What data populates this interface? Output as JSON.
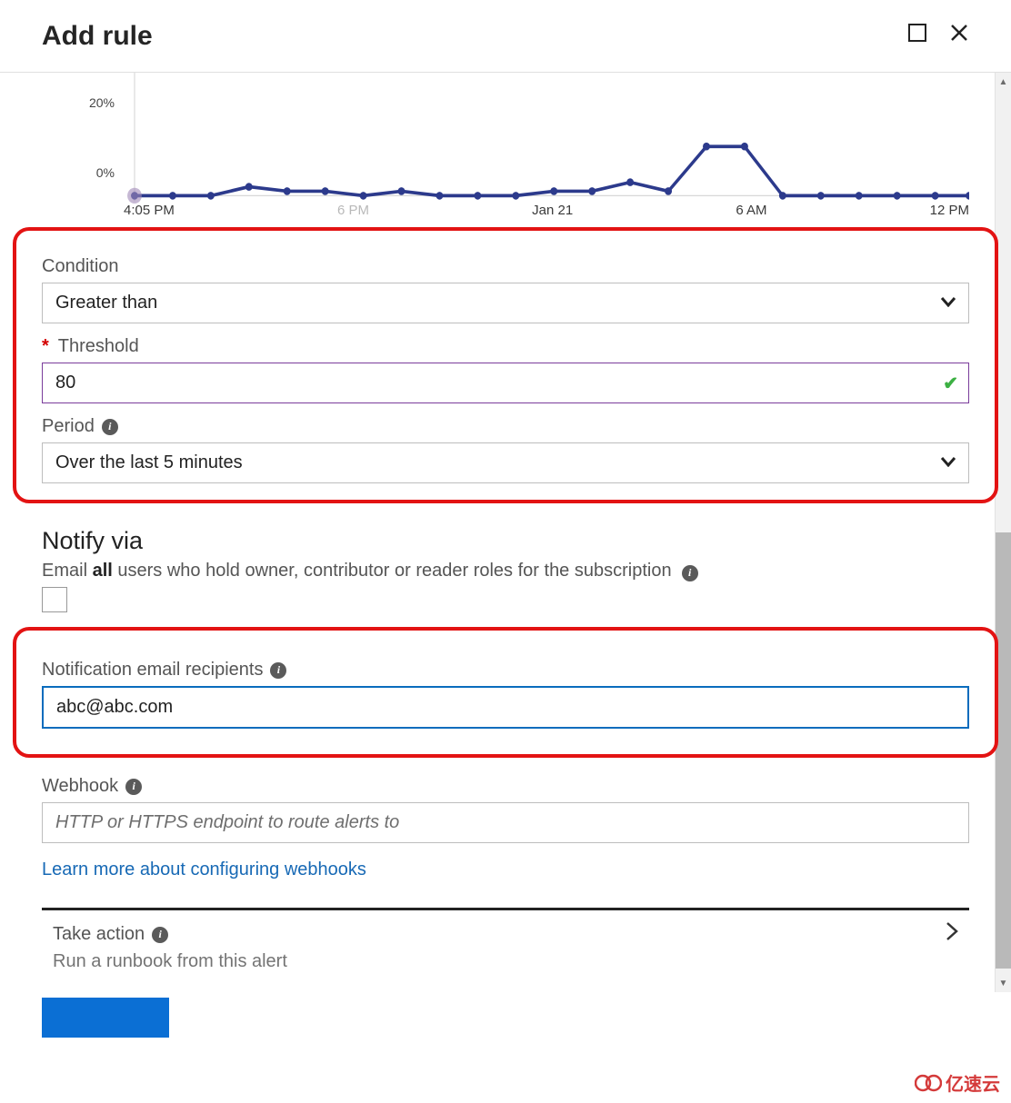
{
  "header": {
    "title": "Add rule"
  },
  "chart_data": {
    "type": "line",
    "title": "",
    "xlabel": "",
    "ylabel": "",
    "ylim": [
      0,
      25
    ],
    "y_ticks": [
      "20%",
      "0%"
    ],
    "x_ticks": [
      "4:05 PM",
      "6 PM",
      "Jan 21",
      "6 AM",
      "12 PM"
    ],
    "x": [
      0,
      1,
      2,
      3,
      4,
      5,
      6,
      7,
      8,
      9,
      10,
      11,
      12,
      13,
      14,
      15,
      16,
      17,
      18,
      19,
      20,
      21,
      22
    ],
    "values": [
      0,
      0,
      0,
      2,
      1,
      1,
      0,
      1,
      0,
      0,
      0,
      1,
      1,
      3,
      1,
      11,
      11,
      0,
      0,
      0,
      0,
      0,
      0
    ]
  },
  "form": {
    "condition_label": "Condition",
    "condition_value": "Greater than",
    "threshold_label": "Threshold",
    "threshold_value": "80",
    "period_label": "Period",
    "period_value": "Over the last 5 minutes"
  },
  "notify": {
    "section_title": "Notify via",
    "email_all_prefix": "Email ",
    "email_all_bold": "all",
    "email_all_suffix": " users who hold owner, contributor or reader roles for the subscription",
    "recipients_label": "Notification email recipients",
    "recipients_value": "abc@abc.com",
    "webhook_label": "Webhook",
    "webhook_placeholder": "HTTP or HTTPS endpoint to route alerts to",
    "learn_more": "Learn more about configuring webhooks",
    "take_action_label": "Take action",
    "runbook_line": "Run a runbook from this alert"
  },
  "watermark": "亿速云"
}
